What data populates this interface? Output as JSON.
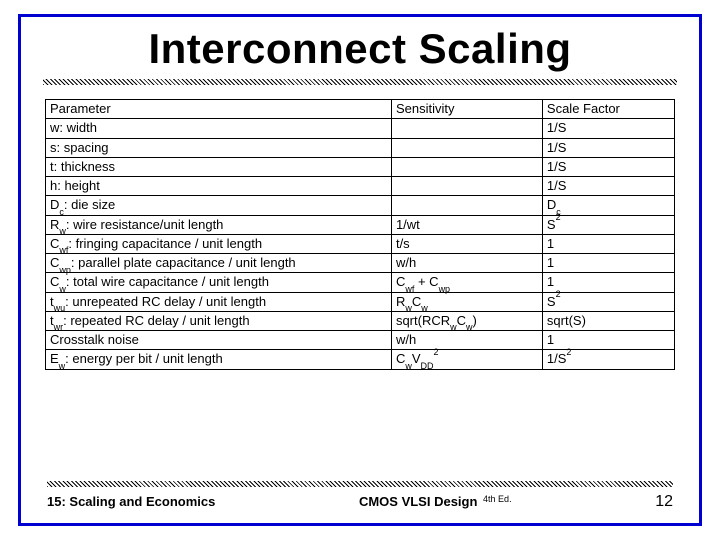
{
  "title": "Interconnect Scaling",
  "table": {
    "headers": {
      "param": "Parameter",
      "sens": "Sensitivity",
      "scale": "Scale Factor"
    },
    "rows": [
      {
        "param": "w: width",
        "sens": "",
        "scale": "1/S"
      },
      {
        "param": "s: spacing",
        "sens": "",
        "scale": "1/S"
      },
      {
        "param": "t: thickness",
        "sens": "",
        "scale": "1/S"
      },
      {
        "param": "h: height",
        "sens": "",
        "scale": "1/S"
      },
      {
        "param": "D<sub>c</sub>: die size",
        "sens": "",
        "scale": "D<sub>c</sub>"
      },
      {
        "param": "R<sub>w</sub>: wire resistance/unit length",
        "sens": "1/wt",
        "scale": "S<sup>2</sup>"
      },
      {
        "param": "C<sub>wf</sub>: fringing capacitance / unit length",
        "sens": "t/s",
        "scale": "1"
      },
      {
        "param": "C<sub>wp</sub>: parallel plate capacitance / unit length",
        "sens": "w/h",
        "scale": "1"
      },
      {
        "param": "C<sub>w</sub>: total wire capacitance / unit length",
        "sens": "C<sub>wf</sub> + C<sub>wp</sub>",
        "scale": "1"
      },
      {
        "param": "t<sub>wu</sub>: unrepeated RC delay / unit length",
        "sens": "R<sub>w</sub>C<sub>w</sub>",
        "scale": "S<sup>2</sup>"
      },
      {
        "param": "t<sub>wr</sub>: repeated RC delay / unit length",
        "sens": "sqrt(RCR<sub>w</sub>C<sub>w</sub>)",
        "scale": "sqrt(S)"
      },
      {
        "param": "Crosstalk noise",
        "sens": "w/h",
        "scale": "1"
      },
      {
        "param": "E<sub>w</sub>: energy per bit / unit length",
        "sens": "C<sub>w</sub>V<sub>DD</sub><sup>2</sup>",
        "scale": "1/S<sup>2</sup>"
      }
    ]
  },
  "footer": {
    "left": "15: Scaling and Economics",
    "center": "CMOS VLSI Design",
    "edition": "4th Ed.",
    "page": "12"
  },
  "chart_data": {
    "type": "table",
    "title": "Interconnect Scaling",
    "columns": [
      "Parameter",
      "Sensitivity",
      "Scale Factor"
    ],
    "rows": [
      [
        "w: width",
        "",
        "1/S"
      ],
      [
        "s: spacing",
        "",
        "1/S"
      ],
      [
        "t: thickness",
        "",
        "1/S"
      ],
      [
        "h: height",
        "",
        "1/S"
      ],
      [
        "Dc: die size",
        "",
        "Dc"
      ],
      [
        "Rw: wire resistance/unit length",
        "1/wt",
        "S^2"
      ],
      [
        "Cwf: fringing capacitance / unit length",
        "t/s",
        "1"
      ],
      [
        "Cwp: parallel plate capacitance / unit length",
        "w/h",
        "1"
      ],
      [
        "Cw: total wire capacitance / unit length",
        "Cwf + Cwp",
        "1"
      ],
      [
        "twu: unrepeated RC delay / unit length",
        "RwCw",
        "S^2"
      ],
      [
        "twr: repeated RC delay / unit length",
        "sqrt(RCRwCw)",
        "sqrt(S)"
      ],
      [
        "Crosstalk noise",
        "w/h",
        "1"
      ],
      [
        "Ew: energy per bit / unit length",
        "CwVDD^2",
        "1/S^2"
      ]
    ]
  }
}
